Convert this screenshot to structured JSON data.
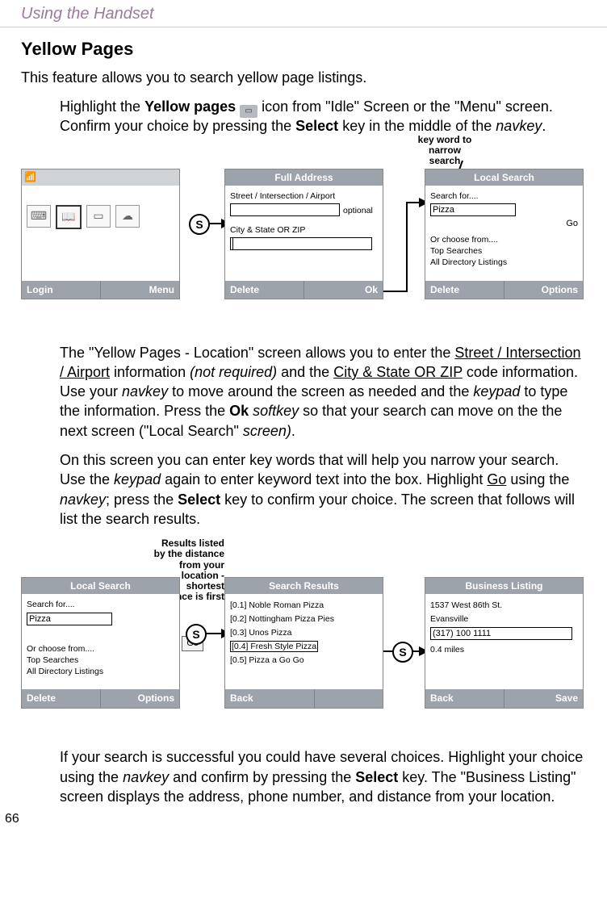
{
  "header": "Using the Handset",
  "page_number": "66",
  "title": "Yellow Pages",
  "intro": "This feature allows you to search yellow page listings.",
  "para1_a": "Highlight the ",
  "para1_b": "Yellow pages",
  "para1_c": " icon from \"Idle\" Screen or the \"Menu\" screen. Confirm your choice by pressing the ",
  "para1_d": "Select",
  "para1_e": " key in the middle of the ",
  "para1_f": "navkey",
  "para1_g": ".",
  "circle_s": "S",
  "annot1": "key word to narrow search",
  "annot2": "Results listed by the distance from your location - shortest distance is first",
  "screens": {
    "idle": {
      "softkeys": {
        "left": "Login",
        "right": "Menu"
      }
    },
    "full_address": {
      "title": "Full Address",
      "line1": "Street / Intersection / Airport",
      "optional": "optional",
      "line2": "City & State OR ZIP",
      "softkeys": {
        "left": "Delete",
        "right": "Ok"
      }
    },
    "local_search": {
      "title": "Local Search",
      "label": "Search for....",
      "input": "Pizza",
      "go": "Go",
      "choose": "Or choose from....",
      "opt1": "Top Searches",
      "opt2": "All Directory Listings",
      "softkeys": {
        "left": "Delete",
        "right": "Options"
      }
    },
    "search_results": {
      "title": "Search Results",
      "itemA": "[0.1] Noble Roman Pizza",
      "itemB": "[0.2] Nottingham Pizza Pies",
      "itemC": "[0.3] Unos Pizza",
      "itemD": "[0.4] Fresh Style Pizza",
      "itemE": "[0.5] Pizza a Go Go",
      "softkeys": {
        "left": "Back"
      }
    },
    "business_listing": {
      "title": "Business Listing",
      "addr1": "1537 West 86th St.",
      "addr2": "Evansville",
      "phone": "(317) 100 1111",
      "dist": "0.4 miles",
      "softkeys": {
        "left": "Back",
        "right": "Save"
      }
    }
  },
  "para2": {
    "a": "The \"Yellow Pages - Location\" screen allows you to enter the ",
    "b": "Street / Intersection / Airport",
    "c": " information ",
    "d": "(not required)",
    "e": " and the ",
    "f": "City & State OR ZIP",
    "g": " code information. Use your ",
    "h": "navkey",
    "i": " to move around the screen as needed and the ",
    "j": "keypad",
    "k": " to type the information. Press the ",
    "l": "Ok",
    "m": " ",
    "n": "softkey",
    "o": " so that your search can move on the the next screen (\"Local Search\" ",
    "p": "screen)",
    "q": "."
  },
  "para3": {
    "a": "On this screen you can enter key words that will help you narrow your search. Use the ",
    "b": "keypad",
    "c": " again to enter keyword text into the box. Highlight ",
    "d": "Go",
    "e": " using the ",
    "f": "navkey",
    "g": "; press the ",
    "h": "Select",
    "i": " key to confirm your choice. The screen that follows will list the search results."
  },
  "para4": {
    "a": "If your search is successful you could have several choices. Highlight your choice using the ",
    "b": "navkey",
    "c": " and confirm by pressing the ",
    "d": "Select",
    "e": " key. The \"Business Listing\" screen displays the address, phone number, and distance from your location."
  }
}
